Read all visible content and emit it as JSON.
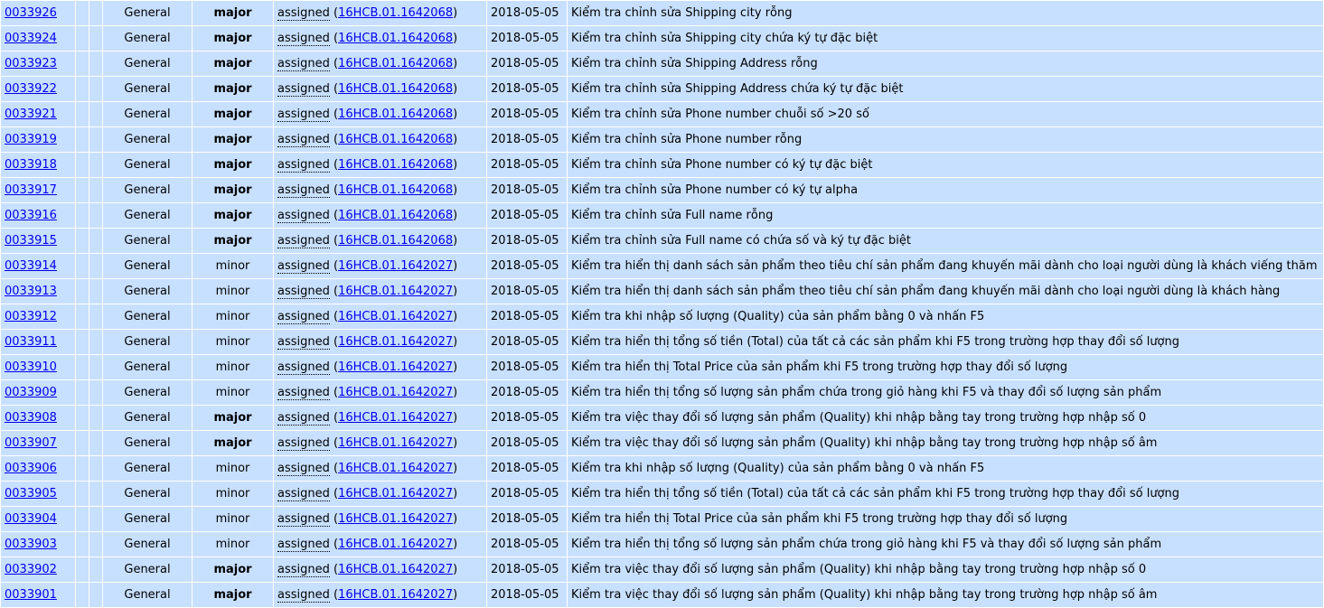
{
  "rows": [
    {
      "id": "0033926",
      "category": "General",
      "severity": "major",
      "status": "assigned",
      "handler": "16HCB.01.1642068",
      "date": "2018-05-05",
      "summary": "Kiểm tra chỉnh sửa Shipping city rỗng"
    },
    {
      "id": "0033924",
      "category": "General",
      "severity": "major",
      "status": "assigned",
      "handler": "16HCB.01.1642068",
      "date": "2018-05-05",
      "summary": "Kiểm tra chỉnh sửa Shipping city chứa ký tự đặc biệt"
    },
    {
      "id": "0033923",
      "category": "General",
      "severity": "major",
      "status": "assigned",
      "handler": "16HCB.01.1642068",
      "date": "2018-05-05",
      "summary": "Kiểm tra chỉnh sửa Shipping Address rỗng"
    },
    {
      "id": "0033922",
      "category": "General",
      "severity": "major",
      "status": "assigned",
      "handler": "16HCB.01.1642068",
      "date": "2018-05-05",
      "summary": "Kiểm tra chỉnh sửa Shipping Address chứa ký tự đặc biệt"
    },
    {
      "id": "0033921",
      "category": "General",
      "severity": "major",
      "status": "assigned",
      "handler": "16HCB.01.1642068",
      "date": "2018-05-05",
      "summary": "Kiểm tra chỉnh sửa Phone number chuỗi số >20 số"
    },
    {
      "id": "0033919",
      "category": "General",
      "severity": "major",
      "status": "assigned",
      "handler": "16HCB.01.1642068",
      "date": "2018-05-05",
      "summary": "Kiểm tra chỉnh sửa Phone number rỗng"
    },
    {
      "id": "0033918",
      "category": "General",
      "severity": "major",
      "status": "assigned",
      "handler": "16HCB.01.1642068",
      "date": "2018-05-05",
      "summary": "Kiểm tra chỉnh sửa Phone number có ký tự đặc biệt"
    },
    {
      "id": "0033917",
      "category": "General",
      "severity": "major",
      "status": "assigned",
      "handler": "16HCB.01.1642068",
      "date": "2018-05-05",
      "summary": "Kiểm tra chỉnh sửa Phone number có ký tự alpha"
    },
    {
      "id": "0033916",
      "category": "General",
      "severity": "major",
      "status": "assigned",
      "handler": "16HCB.01.1642068",
      "date": "2018-05-05",
      "summary": "Kiểm tra chỉnh sửa Full name rỗng"
    },
    {
      "id": "0033915",
      "category": "General",
      "severity": "major",
      "status": "assigned",
      "handler": "16HCB.01.1642068",
      "date": "2018-05-05",
      "summary": "Kiểm tra chỉnh sửa Full name có chứa số và ký tự đặc biệt"
    },
    {
      "id": "0033914",
      "category": "General",
      "severity": "minor",
      "status": "assigned",
      "handler": "16HCB.01.1642027",
      "date": "2018-05-05",
      "summary": "Kiểm tra hiển thị danh sách sản phẩm theo tiêu chí  sản phẩm đang khuyến mãi dành cho loại người dùng là khách viếng thăm"
    },
    {
      "id": "0033913",
      "category": "General",
      "severity": "minor",
      "status": "assigned",
      "handler": "16HCB.01.1642027",
      "date": "2018-05-05",
      "summary": "Kiểm tra hiển thị danh sách sản phẩm theo tiêu chí  sản phẩm đang khuyến mãi dành cho loại người dùng là khách hàng"
    },
    {
      "id": "0033912",
      "category": "General",
      "severity": "minor",
      "status": "assigned",
      "handler": "16HCB.01.1642027",
      "date": "2018-05-05",
      "summary": "Kiểm tra khi nhập số lượng (Quality) của sản phẩm bằng 0 và nhấn F5"
    },
    {
      "id": "0033911",
      "category": "General",
      "severity": "minor",
      "status": "assigned",
      "handler": "16HCB.01.1642027",
      "date": "2018-05-05",
      "summary": "Kiểm tra hiển thị tổng số tiền (Total) của tất cả các sản phẩm khi F5 trong trường hợp thay đổi số lượng"
    },
    {
      "id": "0033910",
      "category": "General",
      "severity": "minor",
      "status": "assigned",
      "handler": "16HCB.01.1642027",
      "date": "2018-05-05",
      "summary": "Kiểm tra hiển thị Total Price của sản phẩm khi F5 trong trường hợp thay đổi số lượng"
    },
    {
      "id": "0033909",
      "category": "General",
      "severity": "minor",
      "status": "assigned",
      "handler": "16HCB.01.1642027",
      "date": "2018-05-05",
      "summary": "Kiểm tra hiển thị tổng số lượng sản phẩm chứa trong giỏ hàng khi F5 và thay đổi số lượng sản phẩm"
    },
    {
      "id": "0033908",
      "category": "General",
      "severity": "major",
      "status": "assigned",
      "handler": "16HCB.01.1642027",
      "date": "2018-05-05",
      "summary": "Kiểm tra việc thay đổi số lượng sản phẩm (Quality) khi nhập bằng tay trong trường hợp nhập số 0"
    },
    {
      "id": "0033907",
      "category": "General",
      "severity": "major",
      "status": "assigned",
      "handler": "16HCB.01.1642027",
      "date": "2018-05-05",
      "summary": "Kiểm tra việc thay đổi số lượng sản phẩm (Quality) khi nhập bằng tay trong trường hợp nhập số âm"
    },
    {
      "id": "0033906",
      "category": "General",
      "severity": "minor",
      "status": "assigned",
      "handler": "16HCB.01.1642027",
      "date": "2018-05-05",
      "summary": "Kiểm tra khi nhập số lượng (Quality) của sản phẩm bằng 0 và nhấn F5"
    },
    {
      "id": "0033905",
      "category": "General",
      "severity": "minor",
      "status": "assigned",
      "handler": "16HCB.01.1642027",
      "date": "2018-05-05",
      "summary": "Kiểm tra hiển thị tổng số tiền (Total) của tất cả các sản phẩm khi F5 trong trường hợp thay đổi số lượng"
    },
    {
      "id": "0033904",
      "category": "General",
      "severity": "minor",
      "status": "assigned",
      "handler": "16HCB.01.1642027",
      "date": "2018-05-05",
      "summary": "Kiểm tra hiển thị Total Price của sản phẩm khi F5 trong trường hợp thay đổi số lượng"
    },
    {
      "id": "0033903",
      "category": "General",
      "severity": "minor",
      "status": "assigned",
      "handler": "16HCB.01.1642027",
      "date": "2018-05-05",
      "summary": "Kiểm tra hiển thị tổng số lượng sản phẩm chứa trong giỏ hàng khi F5 và thay đổi số lượng sản phẩm"
    },
    {
      "id": "0033902",
      "category": "General",
      "severity": "major",
      "status": "assigned",
      "handler": "16HCB.01.1642027",
      "date": "2018-05-05",
      "summary": "Kiểm tra việc thay đổi số lượng sản phẩm (Quality) khi nhập bằng tay trong trường hợp nhập số 0"
    },
    {
      "id": "0033901",
      "category": "General",
      "severity": "major",
      "status": "assigned",
      "handler": "16HCB.01.1642027",
      "date": "2018-05-05",
      "summary": "Kiểm tra việc thay đổi số lượng sản phẩm (Quality) khi nhập bằng tay trong trường hợp nhập số âm"
    }
  ]
}
